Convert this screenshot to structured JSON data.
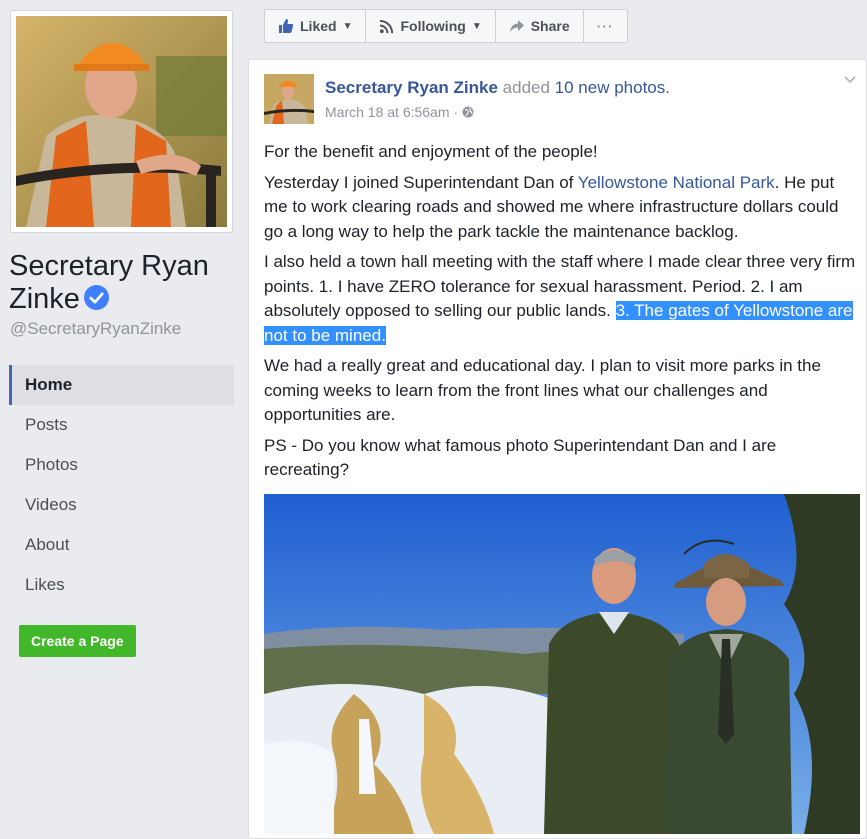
{
  "page": {
    "name": "Secretary Ryan Zinke",
    "handle": "@SecretaryRyanZinke",
    "verified_icon": "verified-badge-icon"
  },
  "nav": {
    "items": [
      {
        "label": "Home",
        "active": true
      },
      {
        "label": "Posts"
      },
      {
        "label": "Photos"
      },
      {
        "label": "Videos"
      },
      {
        "label": "About"
      },
      {
        "label": "Likes"
      }
    ],
    "create_page": "Create a Page"
  },
  "actions": {
    "liked": "Liked",
    "following": "Following",
    "share": "Share",
    "more": "···"
  },
  "post": {
    "author": "Secretary Ryan Zinke",
    "action_text": "added",
    "photos_link": "10 new photos",
    "photos_suffix": ".",
    "timestamp": "March 18 at 6:56am",
    "separator": "·",
    "privacy_icon": "globe-icon",
    "p1": "For the benefit and enjoyment of the people!",
    "p2_a": "Yesterday I joined Superintendant Dan of ",
    "p2_link": "Yellowstone National Park",
    "p2_b": ". He put me to work clearing roads and showed me where infrastructure dollars could go a long way to help the park tackle the maintenance backlog.",
    "p3_a": "I also held a town hall meeting with the staff where I made clear three very firm points. 1. I have ZERO tolerance for sexual harassment. Period. 2. I am absolutely opposed to selling our public lands. ",
    "p3_highlight": "3. The gates of Yellowstone are not to be mined.",
    "p4": "We had a really great and educational day. I plan to visit more parks in the coming weeks to learn from the front lines what our challenges and opportunities are.",
    "p5": "PS - Do you know what famous photo Superintendant Dan and I are recreating?"
  },
  "colors": {
    "link": "#365899",
    "highlight": "#3390ff",
    "create_button": "#42b72a",
    "nav_active_border": "#4267b2"
  }
}
